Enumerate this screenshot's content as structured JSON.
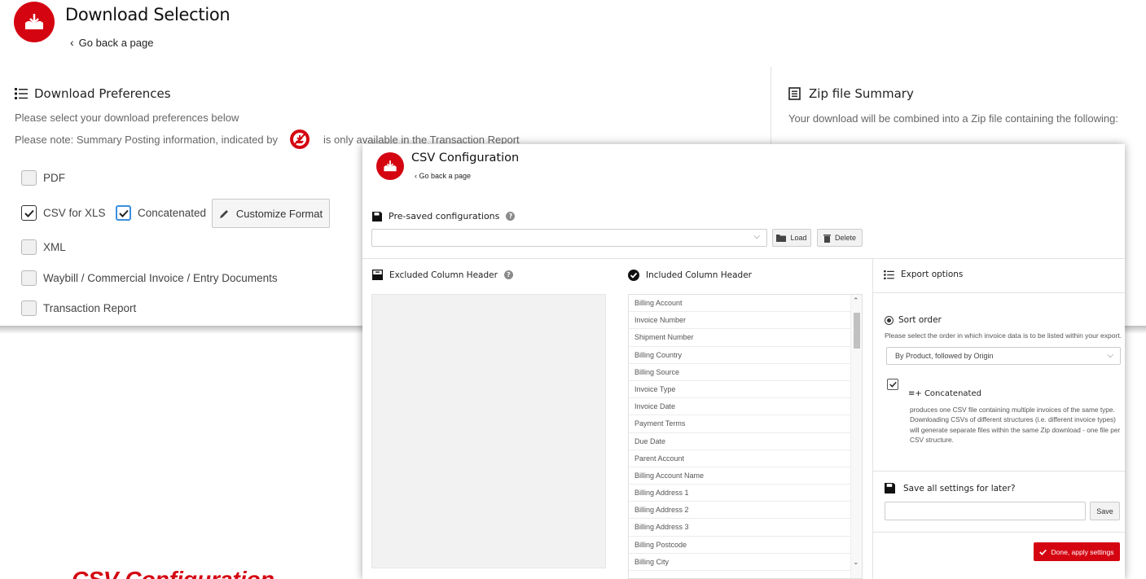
{
  "background": {
    "title": "Download Selection",
    "back_link": "Go back a page",
    "preferences": {
      "title": "Download Preferences",
      "line1": "Please select your download preferences below",
      "line2_before": "Please note: Summary Posting information, indicated by",
      "line2_after": "is only available in the Transaction Report"
    },
    "options": {
      "pdf": "PDF",
      "csv": "CSV for XLS",
      "concatenated": "Concatenated",
      "customize": "Customize Format",
      "xml": "XML",
      "waybill": "Waybill / Commercial Invoice / Entry Documents",
      "transaction": "Transaction Report"
    },
    "zip": {
      "title": "Zip file Summary",
      "text": "Your download will be combined into a Zip file containing the following:"
    },
    "bottom_heading": "CSV Configuration"
  },
  "panel": {
    "title": "CSV Configuration",
    "back_link": "Go back a page",
    "presaved_label": "Pre-saved configurations",
    "load_label": "Load",
    "delete_label": "Delete",
    "excluded_header": "Excluded Column Header",
    "included_header": "Included Column Header",
    "included_columns": [
      "Billing Account",
      "Invoice Number",
      "Shipment Number",
      "Billing Country",
      "Billing Source",
      "Invoice Type",
      "Invoice Date",
      "Payment Terms",
      "Due Date",
      "Parent Account",
      "Billing Account Name",
      "Billing Address 1",
      "Billing Address 2",
      "Billing Address 3",
      "Billing Postcode",
      "Billing City"
    ],
    "export": {
      "title": "Export options",
      "sort_title": "Sort order",
      "sort_desc": "Please select the order in which invoice data is to be listed within your export.",
      "sort_value": "By Product, followed by Origin",
      "conc_title": "Concatenated",
      "conc_desc": "produces one CSV file containing multiple invoices of the same type. Downloading CSVs of different structures (i.e. different invoice types) will generate separate files within the same Zip download - one file per CSV structure.",
      "save_title": "Save all settings for later?",
      "save_label": "Save",
      "done_label": "Done, apply settings"
    }
  },
  "colors": {
    "brand_red": "#d40511",
    "focus_blue": "#3a8fe0"
  }
}
